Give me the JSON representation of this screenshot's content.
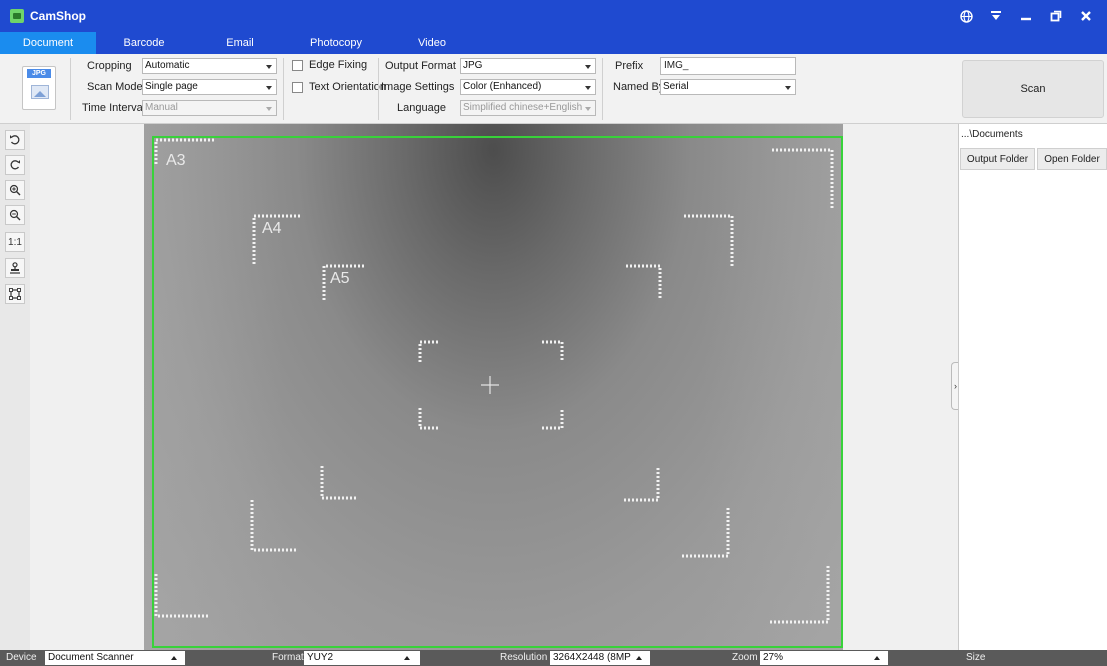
{
  "titlebar": {
    "title": "CamShop"
  },
  "tabs": [
    "Document",
    "Barcode",
    "Email",
    "Photocopy",
    "Video"
  ],
  "toolbar": {
    "format_icon_label": "JPG",
    "cropping_label": "Cropping",
    "cropping_value": "Automatic",
    "scan_mode_label": "Scan Mode",
    "scan_mode_value": "Single page",
    "time_interval_label": "Time Interval",
    "time_interval_value": "Manual",
    "edge_fixing_label": "Edge Fixing",
    "text_orientation_label": "Text Orientation",
    "output_format_label": "Output Format",
    "output_format_value": "JPG",
    "image_settings_label": "Image Settings",
    "image_settings_value": "Color (Enhanced)",
    "language_label": "Language",
    "language_value": "Simplified chinese+English",
    "prefix_label": "Prefix",
    "prefix_value": "IMG_",
    "named_by_label": "Named By",
    "named_by_value": "Serial",
    "scan_label": "Scan"
  },
  "left_tools": {
    "fit_label": "1:1"
  },
  "preview": {
    "paper_labels": {
      "a3": "A3",
      "a4": "A4",
      "a5": "A5"
    }
  },
  "right_panel": {
    "path": "...\\Documents",
    "output_folder_label": "Output Folder",
    "open_folder_label": "Open Folder"
  },
  "statusbar": {
    "device_label": "Device",
    "device_value": "Document Scanner",
    "format_label": "Format",
    "format_value": "YUY2",
    "resolution_label": "Resolution",
    "resolution_value": "3264X2448 (8MP",
    "zoom_label": "Zoom",
    "zoom_value": "27%",
    "size_label": "Size"
  },
  "colors": {
    "titlebar": "#1f4ad0",
    "active_tab": "#1a8cef",
    "crop_frame": "#38d23a",
    "statusbar": "#5a5a5a"
  }
}
